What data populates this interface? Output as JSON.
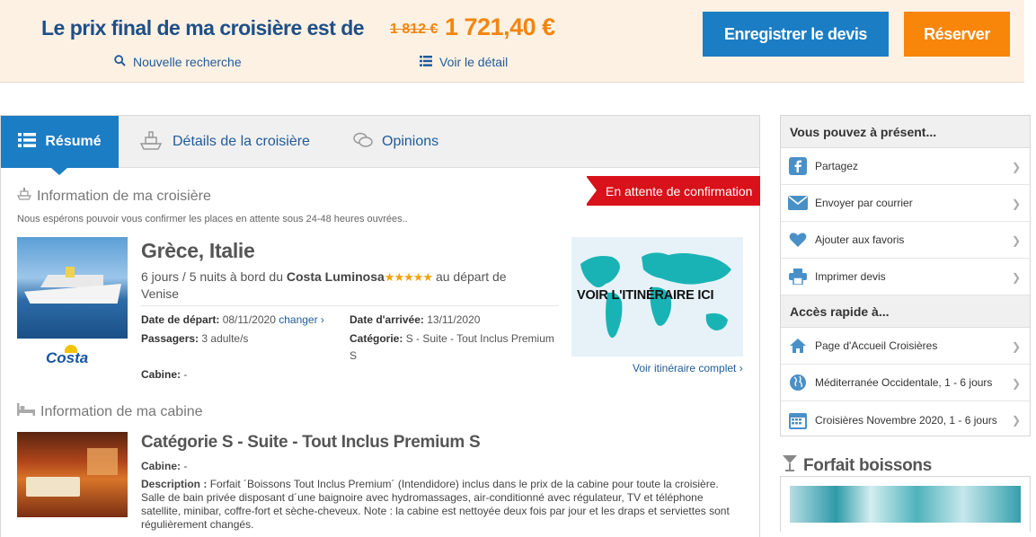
{
  "header": {
    "price_label": "Le prix final de ma croisière est de",
    "old_price": "1 812 €",
    "new_price": "1 721,40 €",
    "new_search": "Nouvelle recherche",
    "view_detail": "Voir le détail",
    "save_quote": "Enregistrer le devis",
    "book": "Réserver"
  },
  "tabs": [
    {
      "label": "Résumé",
      "icon": "list-icon"
    },
    {
      "label": "Détails de la croisière",
      "icon": "ship-icon"
    },
    {
      "label": "Opinions",
      "icon": "chat-icon"
    }
  ],
  "cruise_info": {
    "section_title": "Information de ma croisière",
    "note": "Nous espérons pouvoir vous confirmer les places en attente sous 24-48 heures ouvrées..",
    "status_badge": "En attente de confirmation",
    "title": "Grèce, Italie",
    "desc_prefix": "6 jours / 5 nuits à bord du",
    "ship": "Costa Luminosa",
    "stars": "★★★★★",
    "rating": 4.5,
    "desc_suffix": "au départ de Venise",
    "departure_label": "Date de départ:",
    "departure_value": "08/11/2020",
    "change_link": "changer",
    "arrival_label": "Date d'arrivée:",
    "arrival_value": "13/11/2020",
    "passengers_label": "Passagers:",
    "passengers_value": "3 adulte/s",
    "category_label": "Catégorie:",
    "category_value": "S - Suite - Tout Inclus Premium S",
    "cabin_label": "Cabine:",
    "cabin_value": "-",
    "brand": "Costa",
    "map_text": "VOIR L'ITINÉRAIRE ICI",
    "map_link": "Voir itinéraire complet"
  },
  "cabin_info": {
    "section_title": "Information de ma cabine",
    "title": "Catégorie S - Suite - Tout Inclus Premium S",
    "cabin_label": "Cabine:",
    "cabin_value": "-",
    "desc_label": "Description :",
    "desc_text": "Forfait ´Boissons Tout Inclus Premium´ (Intendidore) inclus dans le prix de la cabine pour toute la croisière. Salle de bain privée disposant d´une baignoire avec hydromassages, air-conditionné avec régulateur, TV et téléphone satellite, minibar, coffre-fort et sèche-cheveux. Note : la cabine est nettoyée deux fois par jour et les draps et serviettes sont régulièrement changés."
  },
  "sidebar": {
    "head1": "Vous pouvez à présent...",
    "actions": [
      {
        "label": "Partagez",
        "icon": "facebook-icon"
      },
      {
        "label": "Envoyer par courrier",
        "icon": "mail-icon"
      },
      {
        "label": "Ajouter aux favoris",
        "icon": "heart-icon"
      },
      {
        "label": "Imprimer devis",
        "icon": "printer-icon"
      }
    ],
    "head2": "Accès rapide à...",
    "quick": [
      {
        "label": "Page d'Accueil Croisières",
        "icon": "home-icon"
      },
      {
        "label": "Méditerranée Occidentale, 1 - 6 jours",
        "icon": "globe-icon"
      },
      {
        "label": "Croisières Novembre 2020, 1 - 6 jours",
        "icon": "calendar-icon"
      }
    ],
    "drinks_title": "Forfait boissons"
  },
  "colors": {
    "navy": "#1f4f86",
    "orange": "#f7860b",
    "blue": "#1b7dc4",
    "red": "#d8111a"
  }
}
